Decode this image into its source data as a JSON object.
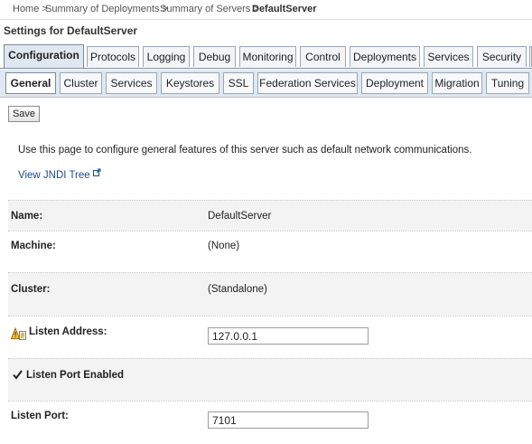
{
  "breadcrumb": {
    "home": "Home >",
    "deployments": "Summary of Deployments >",
    "servers": "Summary of Servers >",
    "current": "DefaultServer"
  },
  "settings_title": "Settings for DefaultServer",
  "tabs_primary": [
    {
      "label": "Configuration",
      "active": true
    },
    {
      "label": "Protocols",
      "active": false
    },
    {
      "label": "Logging",
      "active": false
    },
    {
      "label": "Debug",
      "active": false
    },
    {
      "label": "Monitoring",
      "active": false
    },
    {
      "label": "Control",
      "active": false
    },
    {
      "label": "Deployments",
      "active": false
    },
    {
      "label": "Services",
      "active": false
    },
    {
      "label": "Security",
      "active": false
    }
  ],
  "tabs_secondary": [
    {
      "label": "General",
      "active": true
    },
    {
      "label": "Cluster",
      "active": false
    },
    {
      "label": "Services",
      "active": false
    },
    {
      "label": "Keystores",
      "active": false
    },
    {
      "label": "SSL",
      "active": false
    },
    {
      "label": "Federation Services",
      "active": false
    },
    {
      "label": "Deployment",
      "active": false
    },
    {
      "label": "Migration",
      "active": false
    },
    {
      "label": "Tuning",
      "active": false
    }
  ],
  "save_label": "Save",
  "description": "Use this page to configure general features of this server such as default network communications.",
  "jndi_link": "View JNDI Tree",
  "fields": {
    "name": {
      "label": "Name:",
      "value": "DefaultServer"
    },
    "machine": {
      "label": "Machine:",
      "value": "(None)"
    },
    "cluster": {
      "label": "Cluster:",
      "value": "(Standalone)"
    },
    "listen_address": {
      "label": "Listen Address:",
      "value": "127.0.0.1"
    },
    "listen_port_enabled": {
      "label": "Listen Port Enabled",
      "checked": true
    },
    "listen_port": {
      "label": "Listen Port:",
      "value": "7101"
    }
  },
  "icons": {
    "warning": "warning-icon",
    "external": "external-link-icon",
    "checkbox": "checkbox-icon"
  }
}
